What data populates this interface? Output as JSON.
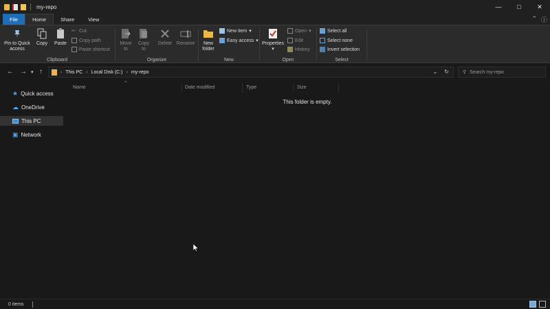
{
  "window": {
    "title": "my-repo"
  },
  "tabs": {
    "file": "File",
    "home": "Home",
    "share": "Share",
    "view": "View"
  },
  "ribbon": {
    "clipboard": {
      "label": "Clipboard",
      "pin": "Pin to Quick access",
      "copy": "Copy",
      "paste": "Paste",
      "cut": "Cut",
      "copy_path": "Copy path",
      "paste_shortcut": "Paste shortcut"
    },
    "organize": {
      "label": "Organize",
      "move_to": "Move to",
      "copy_to": "Copy to",
      "delete": "Delete",
      "rename": "Rename"
    },
    "new": {
      "label": "New",
      "new_folder": "New folder",
      "new_item": "New item",
      "easy_access": "Easy access"
    },
    "open": {
      "label": "Open",
      "properties": "Properties",
      "open": "Open",
      "edit": "Edit",
      "history": "History"
    },
    "select": {
      "label": "Select",
      "select_all": "Select all",
      "select_none": "Select none",
      "invert_selection": "Invert selection"
    }
  },
  "address": {
    "crumbs": [
      "This PC",
      "Local Disk (C:)",
      "my-repo"
    ],
    "search_placeholder": "Search my-repo"
  },
  "nav": {
    "items": [
      "Quick access",
      "OneDrive",
      "This PC",
      "Network"
    ],
    "selected": "This PC"
  },
  "columns": [
    "Name",
    "Date modified",
    "Type",
    "Size"
  ],
  "content": {
    "empty_message": "This folder is empty."
  },
  "status": {
    "items": "0 items"
  },
  "icons": {
    "pin": "pin-icon",
    "copy": "copy-icon",
    "paste": "paste-icon",
    "cut": "scissors-icon",
    "move": "move-to-icon",
    "delete": "delete-icon",
    "rename": "rename-icon",
    "folder": "folder-icon",
    "properties": "properties-icon",
    "search": "search-icon"
  },
  "colors": {
    "accent": "#1f6fb8",
    "folder": "#e8b84b",
    "background": "#191919",
    "ribbon": "#2b2b2b"
  }
}
